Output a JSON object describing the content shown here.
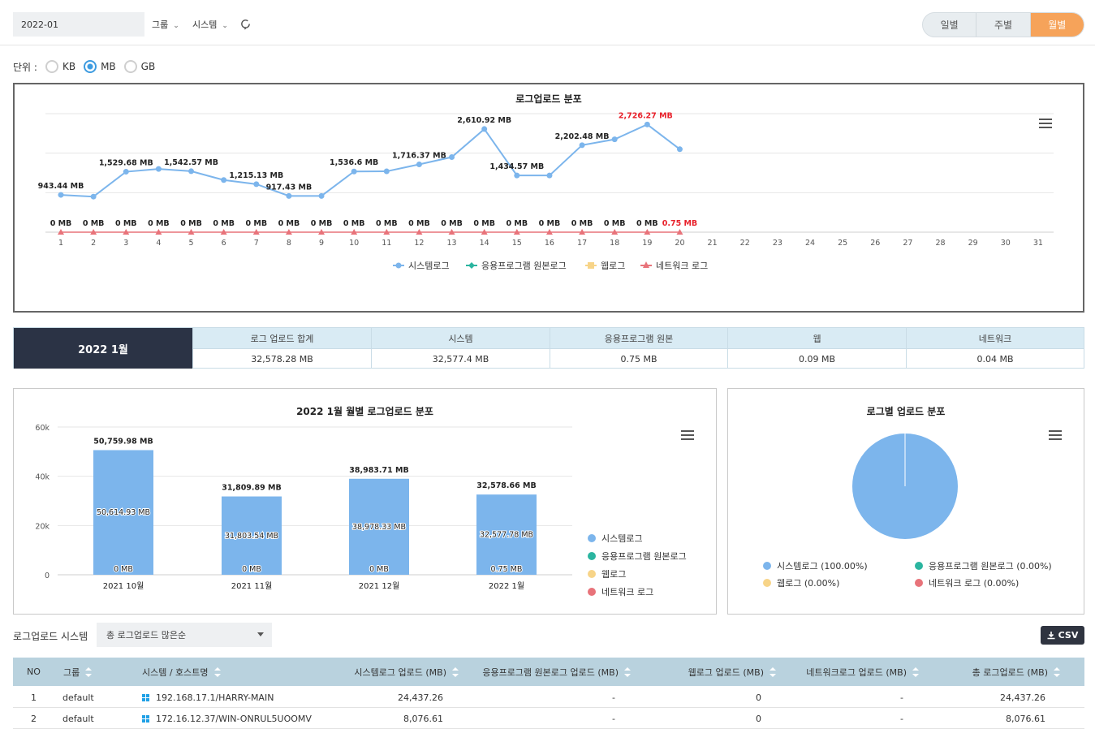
{
  "filters": {
    "date_value": "2022-01",
    "group_label": "그룹",
    "system_label": "시스템"
  },
  "period_toggle": {
    "daily": "일별",
    "weekly": "주별",
    "monthly": "월별",
    "selected": "월별"
  },
  "unit": {
    "label": "단위 :",
    "options": [
      "KB",
      "MB",
      "GB"
    ],
    "selected": "MB"
  },
  "colors": {
    "system": "#7cb5ec",
    "app": "#2bb5a0",
    "web": "#f7d488",
    "network": "#e8737a",
    "accent": "#f6a35a",
    "dark": "#2b3345"
  },
  "summary": {
    "period": "2022 1월",
    "headers": [
      "로그 업로드 합계",
      "시스템",
      "응용프로그램 원본",
      "웹",
      "네트워크"
    ],
    "values": [
      "32,578.28 MB",
      "32,577.4 MB",
      "0.75 MB",
      "0.09 MB",
      "0.04 MB"
    ]
  },
  "table_section": {
    "title": "로그업로드 시스템",
    "sort_value": "총 로그업로드 많은순",
    "csv_label": "CSV",
    "headers": [
      "NO",
      "그룹",
      "시스템 / 호스트명",
      "시스템로그 업로드 (MB)",
      "응용프로그램 원본로그 업로드 (MB)",
      "웹로그 업로드 (MB)",
      "네트워크로그 업로드 (MB)",
      "총 로그업로드 (MB)"
    ],
    "rows": [
      [
        "1",
        "default",
        "192.168.17.1/HARRY-MAIN",
        "24,437.26",
        "-",
        "0",
        "-",
        "24,437.26"
      ],
      [
        "2",
        "default",
        "172.16.12.37/WIN-ONRUL5UOOMV",
        "8,076.61",
        "-",
        "0",
        "-",
        "8,076.61"
      ]
    ]
  },
  "chart_data": [
    {
      "type": "line",
      "title": "로그업로드 분포",
      "x": [
        1,
        2,
        3,
        4,
        5,
        6,
        7,
        8,
        9,
        10,
        11,
        12,
        13,
        14,
        15,
        16,
        17,
        18,
        19,
        20,
        21,
        22,
        23,
        24,
        25,
        26,
        27,
        28,
        29,
        30,
        31
      ],
      "ylim": [
        0,
        3000
      ],
      "grid": true,
      "legend": "bottom",
      "series": [
        {
          "name": "시스템로그",
          "values": [
            943.44,
            900,
            1529.68,
            1600,
            1542.57,
            1320,
            1215.13,
            917.43,
            917.43,
            1536.6,
            1540,
            1716.37,
            1900,
            2610.92,
            1434.57,
            1434.57,
            2202.48,
            2350,
            2726.27,
            2100,
            null,
            null,
            null,
            null,
            null,
            null,
            null,
            null,
            null,
            null,
            null
          ],
          "labels": {
            "1": "943.44 MB",
            "3": "1,529.68 MB",
            "5": "1,542.57 MB",
            "7": "1,215.13 MB",
            "8": "917.43 MB",
            "10": "1,536.6 MB",
            "12": "1,716.37 MB",
            "14": "2,610.92 MB",
            "15": "1,434.57 MB",
            "17": "2,202.48 MB",
            "19": "2,726.27 MB"
          }
        },
        {
          "name": "응용프로그램 원본로그",
          "values": [
            0,
            0,
            0,
            0,
            0,
            0,
            0,
            0,
            0,
            0,
            0,
            0,
            0,
            0,
            0,
            0,
            0,
            0,
            0,
            0.75,
            null,
            null,
            null,
            null,
            null,
            null,
            null,
            null,
            null,
            null,
            null
          ]
        },
        {
          "name": "웹로그",
          "values": [
            0,
            0,
            0,
            0,
            0,
            0,
            0,
            0,
            0,
            0,
            0,
            0,
            0,
            0,
            0,
            0,
            0,
            0,
            0,
            0,
            null,
            null,
            null,
            null,
            null,
            null,
            null,
            null,
            null,
            null,
            null
          ]
        },
        {
          "name": "네트워크 로그",
          "values": [
            0,
            0,
            0,
            0,
            0,
            0,
            0,
            0,
            0,
            0,
            0,
            0,
            0,
            0,
            0,
            0,
            0,
            0,
            0,
            0,
            null,
            null,
            null,
            null,
            null,
            null,
            null,
            null,
            null,
            null,
            null
          ]
        }
      ],
      "bottom_labels": [
        "0 MB",
        "0 MB",
        "0 MB",
        "0 MB",
        "0 MB",
        "0 MB",
        "0 MB",
        "0 MB",
        "0 MB",
        "0 MB",
        "0 MB",
        "0 MB",
        "0 MB",
        "0 MB",
        "0 MB",
        "0 MB",
        "0 MB",
        "0 MB",
        "0 MB",
        "0.75 MB"
      ]
    },
    {
      "type": "bar",
      "title": "2022 1월 월별 로그업로드 분포",
      "categories": [
        "2021 10월",
        "2021 11월",
        "2021 12월",
        "2022 1월"
      ],
      "ylim": [
        0,
        60000
      ],
      "yticks": [
        "0",
        "20k",
        "40k",
        "60k"
      ],
      "legend": "right",
      "totals": [
        "50,759.98 MB",
        "31,809.89 MB",
        "38,983.71 MB",
        "32,578.66 MB"
      ],
      "series": [
        {
          "name": "시스템로그",
          "values": [
            50614.93,
            31803.54,
            38978.33,
            32577.78
          ],
          "labels": [
            "50,614.93 MB",
            "31,803.54 MB",
            "38,978.33 MB",
            "32,577.78 MB"
          ]
        },
        {
          "name": "응용프로그램 원본로그",
          "values": [
            0,
            0,
            0,
            0.75
          ],
          "labels": [
            "0 MB",
            "0 MB",
            "0 MB",
            "0.75 MB"
          ]
        },
        {
          "name": "웹로그",
          "values": [
            0,
            0,
            0,
            0
          ]
        },
        {
          "name": "네트워크 로그",
          "values": [
            0,
            0,
            0,
            0
          ]
        }
      ]
    },
    {
      "type": "pie",
      "title": "로그별 업로드 분포",
      "legend": "bottom",
      "slices": [
        {
          "name": "시스템로그",
          "label": "시스템로그 (100.00%)",
          "value": 100.0
        },
        {
          "name": "응용프로그램 원본로그",
          "label": "응용프로그램 원본로그 (0.00%)",
          "value": 0.0
        },
        {
          "name": "웹로그",
          "label": "웹로그 (0.00%)",
          "value": 0.0
        },
        {
          "name": "네트워크 로그",
          "label": "네트워크 로그 (0.00%)",
          "value": 0.0
        }
      ]
    }
  ]
}
